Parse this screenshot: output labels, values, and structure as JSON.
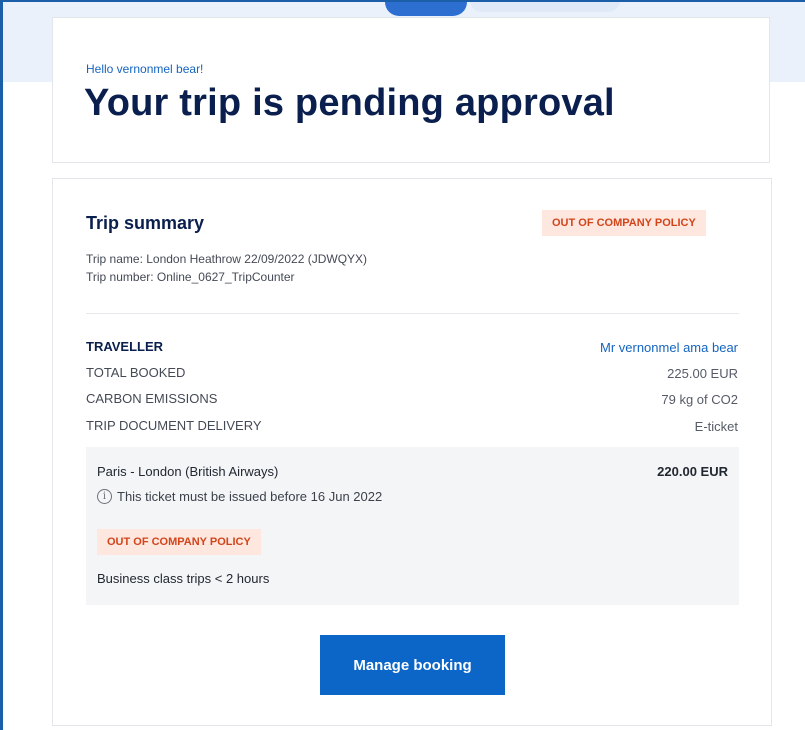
{
  "header": {
    "greeting": "Hello vernonmel bear!",
    "title": "Your trip is pending approval"
  },
  "summary": {
    "title": "Trip summary",
    "policy_badge": "OUT OF COMPANY POLICY",
    "trip_name": "Trip name: London Heathrow 22/09/2022 (JDWQYX)",
    "trip_number": "Trip number: Online_0627_TripCounter",
    "rows": [
      {
        "label": "TRAVELLER",
        "value": "Mr vernonmel ama bear"
      },
      {
        "label": "TOTAL BOOKED",
        "value": "225.00 EUR"
      },
      {
        "label": "CARBON EMISSIONS",
        "value": "79 kg of CO2"
      },
      {
        "label": "TRIP DOCUMENT DELIVERY",
        "value": "E-ticket"
      }
    ]
  },
  "segment": {
    "route": "Paris - London (British Airways)",
    "price": "220.00 EUR",
    "info_icon": "info-icon",
    "info_glyph": "i",
    "info_text": "This ticket must be issued before 16 Jun 2022",
    "policy_badge": "OUT OF COMPANY POLICY",
    "policy_reason": "Business class trips < 2 hours"
  },
  "actions": {
    "manage_booking_label": "Manage booking"
  },
  "colors": {
    "brand_blue": "#0b66c8",
    "title_navy": "#0a1f4d",
    "policy_red": "#d2451b",
    "policy_bg": "#fde7df",
    "band": "#eaf1fb"
  }
}
